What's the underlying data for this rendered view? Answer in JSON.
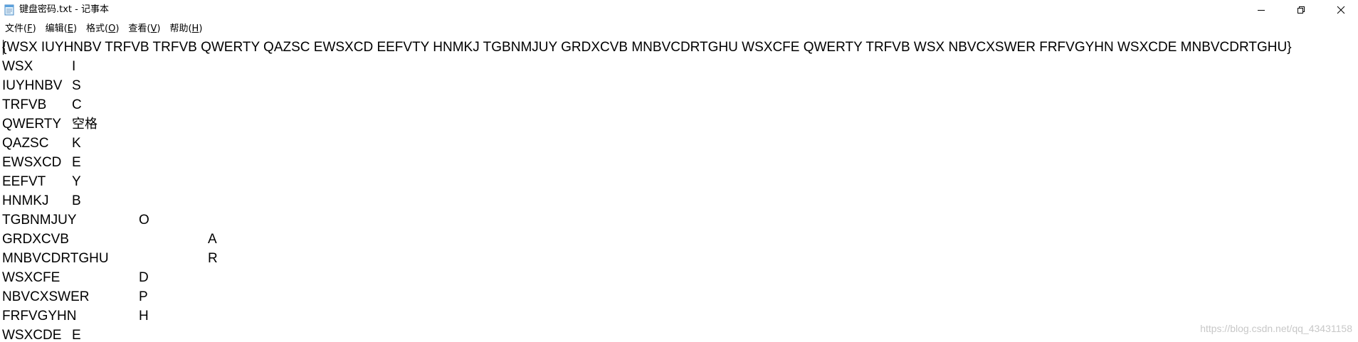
{
  "window": {
    "title": "键盘密码.txt - 记事本",
    "controls": {
      "minimize": "minimize",
      "maximize": "restore",
      "close": "close"
    }
  },
  "menu": {
    "items": [
      {
        "label": "文件(F)",
        "prefix": "文件(",
        "key": "F",
        "suffix": ")"
      },
      {
        "label": "编辑(E)",
        "prefix": "编辑(",
        "key": "E",
        "suffix": ")"
      },
      {
        "label": "格式(O)",
        "prefix": "格式(",
        "key": "O",
        "suffix": ")"
      },
      {
        "label": "查看(V)",
        "prefix": "查看(",
        "key": "V",
        "suffix": ")"
      },
      {
        "label": "帮助(H)",
        "prefix": "帮助(",
        "key": "H",
        "suffix": ")"
      }
    ]
  },
  "editor": {
    "first_line": "{WSX IUYHNBV TRFVB TRFVB QWERTY QAZSC EWSXCD EEFVTY HNMKJ TGBNMJUY GRDXCVB MNBVCDRTGHU WSXCFE QWERTY TRFVB WSX NBVCXSWER FRFVGYHN WSXCDE MNBVCDRTGHU}",
    "rows": [
      {
        "code": "WSX",
        "letter": "I",
        "col": 1
      },
      {
        "code": "IUYHNBV",
        "letter": "S",
        "col": 1
      },
      {
        "code": "TRFVB",
        "letter": "C",
        "col": 1
      },
      {
        "code": "QWERTY",
        "letter": "空格",
        "col": 1
      },
      {
        "code": "QAZSC",
        "letter": "K",
        "col": 1
      },
      {
        "code": "EWSXCD",
        "letter": "E",
        "col": 1
      },
      {
        "code": "EEFVT",
        "letter": "Y",
        "col": 1
      },
      {
        "code": "HNMKJ",
        "letter": "B",
        "col": 1
      },
      {
        "code": "TGBNMJUY",
        "letter": "O",
        "col": 2
      },
      {
        "code": "GRDXCVB",
        "letter": "A",
        "col": 3
      },
      {
        "code": "MNBVCDRTGHU",
        "letter": "R",
        "col": 3
      },
      {
        "code": "WSXCFE",
        "letter": "D",
        "col": 2
      },
      {
        "code": "NBVCXSWER",
        "letter": "P",
        "col": 2
      },
      {
        "code": "FRFVGYHN",
        "letter": "H",
        "col": 2
      },
      {
        "code": "WSXCDE",
        "letter": "E",
        "col": 1
      }
    ]
  },
  "watermark": "https://blog.csdn.net/qq_43431158"
}
